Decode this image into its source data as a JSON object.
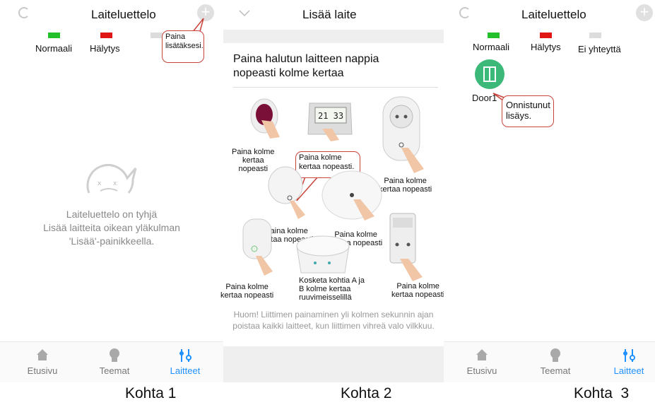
{
  "panel1": {
    "title": "Laiteluettelo",
    "legend": [
      {
        "label": "Normaali",
        "color": "#22c02a"
      },
      {
        "label": "Hälytys",
        "color": "#e01616"
      }
    ],
    "callout": "Paina lisätäksesi.",
    "empty_line1": "Laiteluettelo on tyhjä",
    "empty_line2": "Lisää laitteita oikean yläkulman",
    "empty_line3": "'Lisää'-painikkeella.",
    "tabs": [
      {
        "label": "Etusivu",
        "icon": "home-icon",
        "active": false
      },
      {
        "label": "Teemat",
        "icon": "bulb-icon",
        "active": false
      },
      {
        "label": "Laitteet",
        "icon": "sliders-icon",
        "active": true
      }
    ],
    "caption": "Kohta 1"
  },
  "panel2": {
    "title": "Lisää laite",
    "heading_line1": "Paina halutun laitteen nappia",
    "heading_line2": "nopeasti kolme kertaa",
    "labels": {
      "btn1": [
        "Paina kolme",
        "kertaa",
        "nopeasti"
      ],
      "callout": [
        "Paina kolme",
        "kertaa nopeasti."
      ],
      "plug": [
        "Paina kolme",
        "kertaa nopeasti"
      ],
      "mid1": [
        "Paina kolme",
        "kertaa nopeasti"
      ],
      "mid2": [
        "Paina kolme",
        "kertaa nopeasti"
      ],
      "bl": [
        "Paina kolme",
        "kertaa nopeasti"
      ],
      "scale": [
        "Kosketa kohtia A ja",
        "B kolme kertaa",
        "ruuvimeisselillä"
      ],
      "br": [
        "Paina kolme",
        "kertaa nopeasti"
      ]
    },
    "note_line1": "Huom! Liittimen painaminen yli kolmen sekunnin ajan",
    "note_line2": "poistaa kaikki laitteet, kun liittimen vihreä valo vilkkuu.",
    "clock_display": "21 33",
    "caption": "Kohta 2"
  },
  "panel3": {
    "title": "Laiteluettelo",
    "legend": [
      {
        "label": "Normaali",
        "color": "#22c02a"
      },
      {
        "label": "Hälytys",
        "color": "#e01616"
      },
      {
        "label": "Ei yhteyttä",
        "color": "#dcdcdc"
      }
    ],
    "device_name": "Door1",
    "device_color": "#3cb878",
    "callout": "Onnistunut lisäys.",
    "tabs": [
      {
        "label": "Etusivu",
        "icon": "home-icon",
        "active": false
      },
      {
        "label": "Teemat",
        "icon": "bulb-icon",
        "active": false
      },
      {
        "label": "Laitteet",
        "icon": "sliders-icon",
        "active": true
      }
    ],
    "caption": "Kohta  3"
  }
}
